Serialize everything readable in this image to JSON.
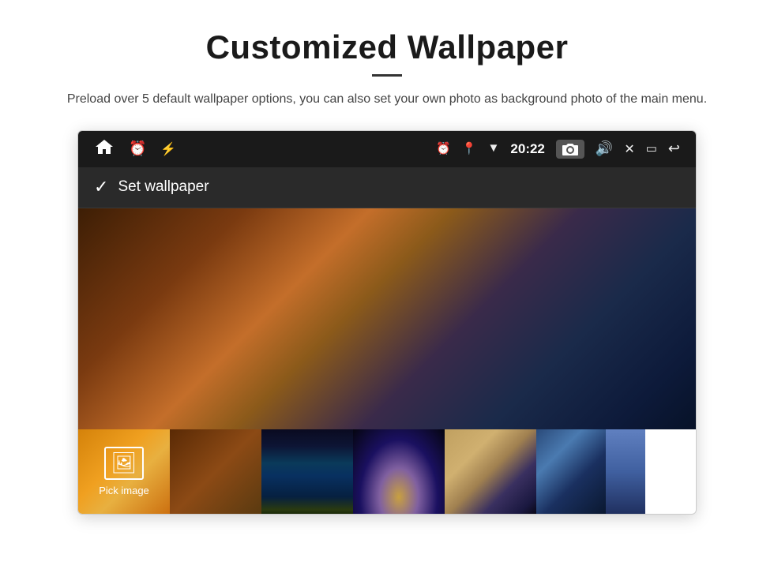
{
  "header": {
    "title": "Customized Wallpaper",
    "subtitle": "Preload over 5 default wallpaper options, you can also set your own photo as background photo of the main menu.",
    "divider_visible": true
  },
  "status_bar": {
    "time": "20:22",
    "left_icons": [
      "home",
      "alarm",
      "usb"
    ],
    "right_icons": [
      "alarm",
      "location",
      "wifi",
      "time",
      "camera",
      "volume",
      "close",
      "window",
      "back"
    ]
  },
  "app_bar": {
    "title": "Set wallpaper",
    "checkmark_label": "✓"
  },
  "thumbnail_strip": {
    "pick_image_label": "Pick image",
    "thumbnails_count": 6
  }
}
